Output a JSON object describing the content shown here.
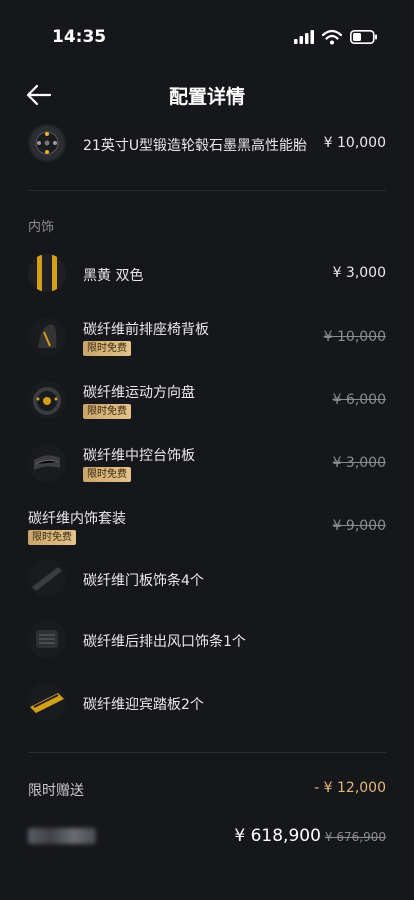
{
  "status": {
    "time": "14:35"
  },
  "header": {
    "title": "配置详情"
  },
  "wheel": {
    "name": "21英寸U型锻造轮毂石墨黑高性能胎",
    "price": "¥ 10,000"
  },
  "interior_section": {
    "label": "内饰"
  },
  "interior_items": [
    {
      "name": "黑黄 双色",
      "price": "¥ 3,000"
    },
    {
      "name": "碳纤维前排座椅背板",
      "badge": "限时免费",
      "price": "¥ 10,000"
    },
    {
      "name": "碳纤维运动方向盘",
      "badge": "限时免费",
      "price": "¥ 6,000"
    },
    {
      "name": "碳纤维中控台饰板",
      "badge": "限时免费",
      "price": "¥ 3,000"
    }
  ],
  "package": {
    "name": "碳纤维内饰套装",
    "badge": "限时免费",
    "price": "¥ 9,000",
    "items": [
      {
        "name": "碳纤维门板饰条4个"
      },
      {
        "name": "碳纤维后排出风口饰条1个"
      },
      {
        "name": "碳纤维迎宾踏板2个"
      }
    ]
  },
  "gift": {
    "label": "限时赠送",
    "value": "- ¥ 12,000"
  },
  "total": {
    "price": "¥ 618,900",
    "original": "¥ 676,900"
  },
  "colors": {
    "background": "#16171b",
    "badge": "#d6b57c",
    "gift": "#e6b877",
    "muted": "#8a8b90"
  },
  "icons": [
    "signal-icon",
    "wifi-icon",
    "battery-icon",
    "back-arrow-icon"
  ]
}
